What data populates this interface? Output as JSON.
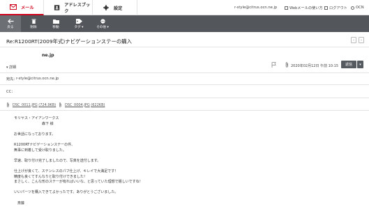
{
  "nav": {
    "tabs": [
      {
        "label": "メール",
        "icon": "mail-icon",
        "active": true
      },
      {
        "label": "アドレスブック",
        "icon": "address-book-icon",
        "active": false
      },
      {
        "label": "設定",
        "icon": "gear-icon",
        "active": false
      }
    ],
    "account": "r-style@citrus.ocn.ne.jp",
    "webmail_link": "Webメールの使い方",
    "logout": "ログアウト",
    "brand": "OCN",
    "accent_color": "#d0021b"
  },
  "toolbar": {
    "back": "戻る",
    "delete": "削除",
    "move": "移動",
    "tag": "タグ",
    "other": "その他"
  },
  "message": {
    "subject": "Re:R1200RT(2009年式)ナビゲーションステーの購入",
    "sender": "ne.jp",
    "detail_toggle": "詳細",
    "date": "2020年02月12日 午前 10:15",
    "reply": "返信",
    "to_label": "宛先：",
    "to_value": "r-style@citrus.ocn.ne.jp",
    "cc_label": "CC：",
    "attachments": [
      {
        "name": "DSC_0011.JPG",
        "size": "(724.9KB)"
      },
      {
        "name": "DSC_0004.JPG",
        "size": "(622KB)"
      }
    ],
    "body": [
      "モリヤス・アイアンワークス",
      "　　　　　　　　森下 様",
      "",
      "お世話になっております。",
      "",
      "R1200RTナビゲーションステーの件、",
      "無事に到着して受け取りました。",
      "",
      "早速、取り付け完了しましたので、写真を送付します。",
      "",
      "仕上げが良くて、ステンレスのパフ仕上げ、キレイで大満足です！",
      "精度も良くてすんなりと取り付けできました！",
      "まさしく、こんな形のステーが有ればいいな、と思っていた理想で嬉しいですね！",
      "",
      "いいパーツを購入できてよかったです。ありがとうございました。",
      "",
      "　斎藤"
    ]
  }
}
